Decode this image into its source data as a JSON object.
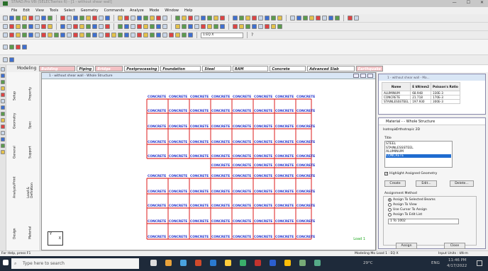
{
  "window": {
    "title": "STAAD.Pro V8i (SELECTseries 6) - [1 - without shear wall]"
  },
  "menu": [
    "File",
    "Edit",
    "View",
    "Tools",
    "Select",
    "Geometry",
    "Commands",
    "Analyze",
    "Mode",
    "Window",
    "Help"
  ],
  "toolbar": {
    "combo_load": "1:EQ X",
    "help_symbol": "?"
  },
  "mode_tabs": [
    "Modeling",
    "Building Planner",
    "Piping",
    "Bridge Deck",
    "Postprocessing",
    "Foundation Design",
    "Steel Design",
    "RAM Connection",
    "Concrete Design",
    "Advanced Slab Design",
    "Earthquake"
  ],
  "page_tabs_outer": [
    "Setup",
    "Geometry",
    "General",
    "Analysis/Print",
    "Design"
  ],
  "page_tabs_inner": [
    "Property",
    "Spec",
    "Support",
    "Load & Definition",
    "Material"
  ],
  "viewport": {
    "title": "1 - without shear wall - Whole Structure",
    "load_label": "Load 1",
    "axis_label_y": "Y",
    "axis_label_x": "X",
    "member_label": "CONCRETE"
  },
  "material_table": {
    "title": "1 - without shear wall - Ma...",
    "headers": [
      "Name",
      "E kN/mm2",
      "Poisson's Ratio"
    ],
    "rows": [
      [
        "ALUMINUM",
        "68.948",
        "330E-3"
      ],
      [
        "CONCRETE",
        "21.718",
        "170E-3"
      ],
      [
        "STAINLESSSTEEL",
        "197.930",
        "300E-3"
      ]
    ]
  },
  "material_panel": {
    "title": "Material - - Whole Structure",
    "isotropic": "Isotropic",
    "orthotropic": "Orthotropic 2D",
    "list_header": "Title",
    "items": [
      "STEEL",
      "STAINLESSSTEEL",
      "ALUMINUM",
      "CONCRETE"
    ],
    "selected": "CONCRETE",
    "highlight": "Highlight Assigned Geometry",
    "buttons": {
      "create": "Create",
      "edit": "Edit...",
      "delete": "Delete..."
    },
    "assignment_method": "Assignment Method",
    "options": [
      "Assign To Selected Beams",
      "Assign To View",
      "Use Cursor To Assign",
      "Assign To Edit List"
    ],
    "edit_list": "1 To 1002",
    "assign": "Assign",
    "close": "Close"
  },
  "status": {
    "help": "For Help, press F1",
    "mode": "Modeling Mo Load 1 : EQ X",
    "units": "Input Units : kN-m"
  },
  "taskbar": {
    "search": "Type here to search",
    "weather": "29°C",
    "lang": "ENG",
    "time": "11:46 PM",
    "date": "4/17/2022"
  },
  "colors": {
    "frame": "#e03030",
    "member_text": "#2233cc",
    "accent": "#1f6cd0"
  }
}
